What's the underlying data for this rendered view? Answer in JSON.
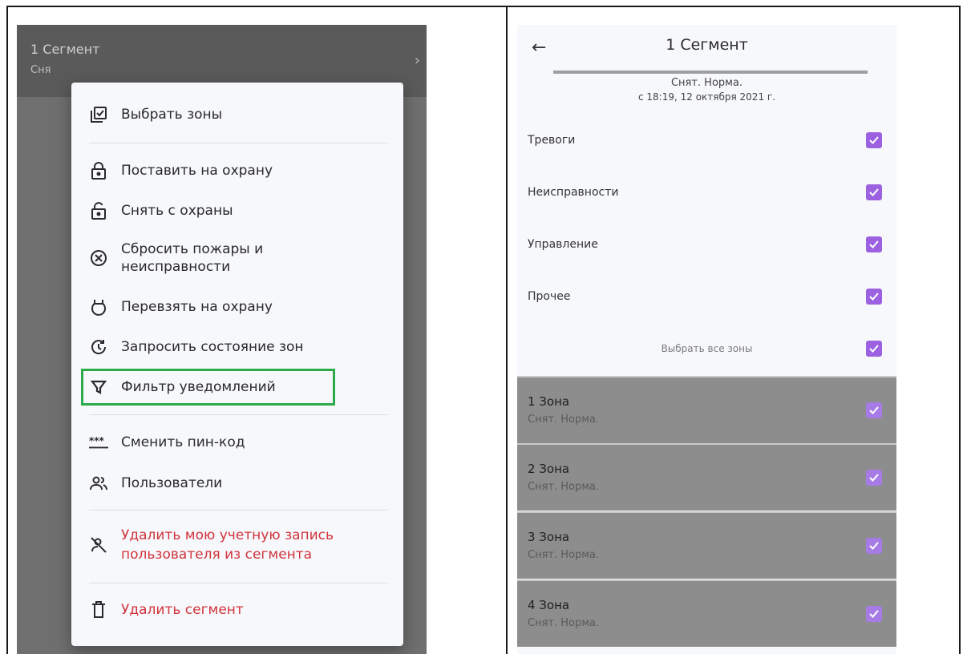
{
  "left": {
    "header": {
      "title": "1 Сегмент",
      "subtitle": "Сня",
      "chevron_icon": "chevron-right-icon"
    },
    "menu": {
      "items": [
        {
          "label": "Выбрать зоны",
          "icon": "select-zones-icon"
        },
        {
          "label": "Поставить на охрану",
          "icon": "lock-icon"
        },
        {
          "label": "Снять с охраны",
          "icon": "unlock-icon"
        },
        {
          "label": "Сбросить пожары и\nнеисправности",
          "icon": "cancel-circle-icon"
        },
        {
          "label": "Перевзять на охрану",
          "icon": "rearm-icon"
        },
        {
          "label": "Запросить состояние зон",
          "icon": "request-status-icon"
        },
        {
          "label": "Фильтр уведомлений",
          "icon": "filter-icon"
        },
        {
          "label": "Сменить пин-код",
          "icon": "pin-code-icon"
        },
        {
          "label": "Пользователи",
          "icon": "users-icon"
        },
        {
          "label": "Удалить мою учетную запись\nпользователя из сегмента",
          "icon": "remove-user-icon",
          "danger": true
        },
        {
          "label": "Удалить сегмент",
          "icon": "trash-icon",
          "danger": true
        }
      ],
      "highlight_color": "#2daa4a",
      "danger_color": "#d0343b"
    }
  },
  "right": {
    "header": {
      "back_icon": "arrow-left-icon",
      "title": "1 Сегмент"
    },
    "status": "Снят. Норма.",
    "since": "с 18:19, 12 октября 2021 г.",
    "filters": [
      {
        "label": "Тревоги",
        "checked": true
      },
      {
        "label": "Неисправности",
        "checked": true
      },
      {
        "label": "Управление",
        "checked": true
      },
      {
        "label": "Прочее",
        "checked": true
      }
    ],
    "select_all": {
      "label": "Выбрать все зоны",
      "checked": true
    },
    "zones": [
      {
        "name": "1 Зона",
        "status": "Снят. Норма.",
        "checked": true
      },
      {
        "name": "2 Зона",
        "status": "Снят. Норма.",
        "checked": true
      },
      {
        "name": "3 Зона",
        "status": "Снят. Норма.",
        "checked": true
      },
      {
        "name": "4 Зона",
        "status": "Снят. Норма.",
        "checked": true
      }
    ],
    "checkbox_color": "#9b61e0"
  }
}
